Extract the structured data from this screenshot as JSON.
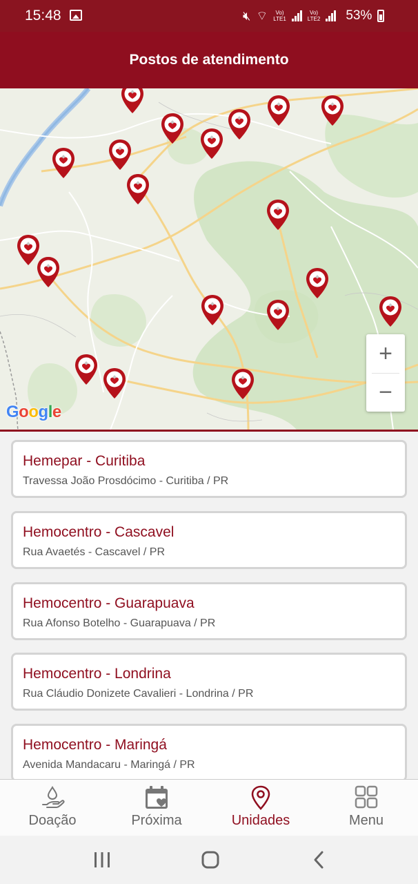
{
  "status_bar": {
    "time": "15:48",
    "battery": "53%",
    "icons": [
      "image-icon",
      "mute-icon",
      "wifi-icon",
      "volte-lte1-icon",
      "signal-icon",
      "volte-lte2-icon",
      "signal-icon",
      "battery-icon"
    ]
  },
  "header": {
    "title": "Postos de atendimento"
  },
  "map": {
    "zoom_in": "+",
    "zoom_out": "−",
    "attribution": "Google",
    "marker_color": "#b5121b"
  },
  "units": [
    {
      "name": "Hemepar - Curitiba",
      "address": "Travessa João Prosdócimo - Curitiba / PR"
    },
    {
      "name": "Hemocentro - Cascavel",
      "address": "Rua Avaetés - Cascavel / PR"
    },
    {
      "name": "Hemocentro - Guarapuava",
      "address": "Rua Afonso Botelho - Guarapuava / PR"
    },
    {
      "name": "Hemocentro - Londrina",
      "address": "Rua Cláudio Donizete Cavalieri - Londrina / PR"
    },
    {
      "name": "Hemocentro - Maringá",
      "address": "Avenida Mandacaru - Maringá / PR"
    }
  ],
  "bottom_nav": [
    {
      "label": "Doação",
      "icon": "hand-drop-icon",
      "active": false
    },
    {
      "label": "Próxima",
      "icon": "calendar-heart-icon",
      "active": false
    },
    {
      "label": "Unidades",
      "icon": "location-pin-icon",
      "active": true
    },
    {
      "label": "Menu",
      "icon": "grid-icon",
      "active": false
    }
  ],
  "colors": {
    "primary": "#8f0e1f",
    "status_bar": "#8a1420",
    "inactive": "#666666"
  }
}
